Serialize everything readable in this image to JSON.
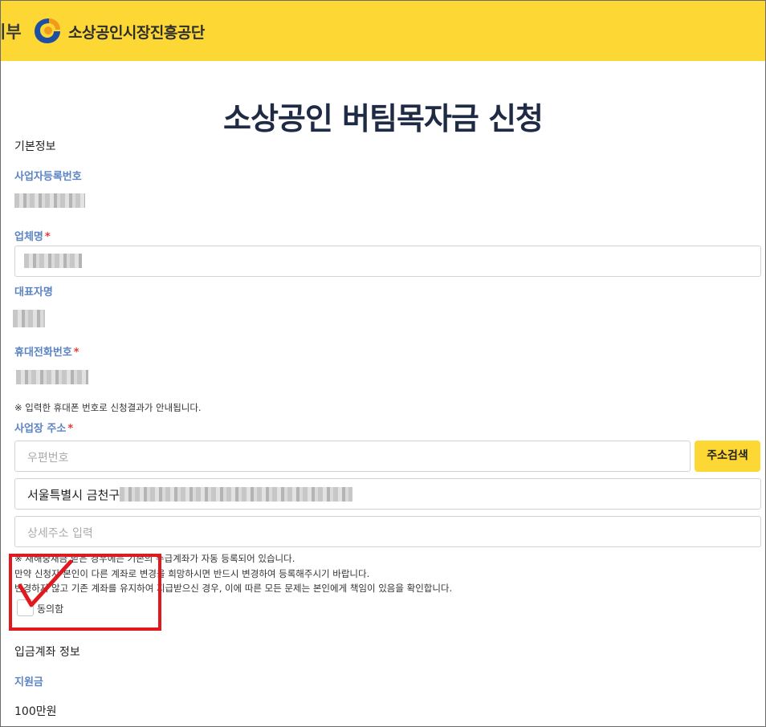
{
  "header": {
    "gov_text": "기부",
    "org_name": "소상공인시장진흥공단"
  },
  "page_title": "소상공인 버팀목자금 신청",
  "basic_info": {
    "section_title": "기본정보",
    "business_reg_label": "사업자등록번호",
    "company_name_label": "업체명",
    "ceo_name_label": "대표자명",
    "phone_label": "휴대전화번호",
    "phone_notice": "※ 입력한 휴대폰 번호로 신청결과가 안내됩니다.",
    "address_label": "사업장 주소",
    "required_mark": "*",
    "postal_placeholder": "우편번호",
    "address_search_button": "주소검색",
    "address_value": "서울특별시 금천구",
    "detail_address_placeholder": "상세주소 입력"
  },
  "account_notice": {
    "line1": "※ 재해중재금 받은 경우에는 기존의 수급계좌가 자동 등록되어 있습니다.",
    "line2": "만약 신청자 본인이 다른 계좌로 변경을 희망하시면 반드시 변경하여 등록해주시기 바랍니다.",
    "line3": "변경하지 않고 기존 계좌를 유지하여 지급받으신 경우, 이에 따른 모든 문제는 본인에게 책임이 있음을 확인합니다.",
    "agree_label": "동의함"
  },
  "deposit_info": {
    "section_title": "입금계좌 정보",
    "support_label": "지원금",
    "support_value": "100만원"
  },
  "colors": {
    "header_bg": "#fdd835",
    "label_blue": "#5b84c4",
    "title_navy": "#1f2a44",
    "annotation_red": "#e0191f"
  }
}
